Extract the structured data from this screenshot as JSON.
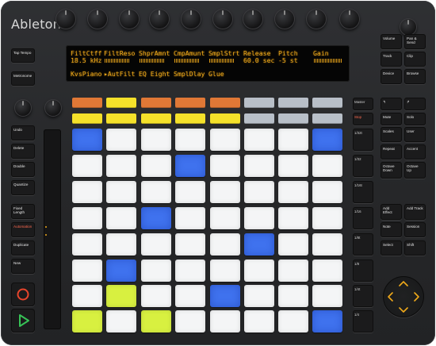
{
  "brand": "Ableton",
  "display": {
    "row1": [
      "FiltCtff",
      "FiltReso",
      "ShprAmnt",
      "CmpAmunt",
      "SmplStrt",
      "Release",
      "Pitch",
      "Gain"
    ],
    "row2": [
      "18.5 kHz",
      "",
      "",
      "",
      "",
      "60.0 sec",
      "-5 st",
      ""
    ],
    "row3": [
      "KvsPiano",
      "▸AutFilt",
      "EQ Eight",
      "SmplDlay",
      "Glue"
    ],
    "color": "#f0a91a"
  },
  "left_buttons": {
    "tap_tempo": "Tap Tempo",
    "metronome": "Metronome",
    "undo": "Undo",
    "delete": "Delete",
    "double": "Double",
    "quantize": "Quantize",
    "fixed_length": "Fixed Length",
    "automation": "Automation",
    "duplicate": "Duplicate",
    "new": "New"
  },
  "right_buttons": {
    "volume": "Volume",
    "pan_send": "Pan & Send",
    "track": "Track",
    "clip": "Clip",
    "device": "Device",
    "browse": "Browse",
    "nav_left": "↰",
    "nav_right": "↱",
    "mute": "Mute",
    "solo": "Solo",
    "scales": "Scales",
    "user": "User",
    "repeat": "Repeat",
    "accent": "Accent",
    "octave_down": "Octave Down",
    "octave_up": "Octave Up",
    "add_effect": "Add Effect",
    "add_track": "Add Track",
    "note": "Note",
    "session": "Session",
    "select": "Select",
    "shift": "Shift"
  },
  "scene_buttons": {
    "master": "Master",
    "stop": "Stop",
    "labels": [
      "1/32t",
      "1/32",
      "1/16t",
      "1/16",
      "1/8t",
      "1/8",
      "1/4t",
      "1/4"
    ]
  },
  "track_select_colors": [
    "#e07836",
    "#f5e12a",
    "#e07836",
    "#e07836",
    "#e07836",
    "#b8bfc8",
    "#b8bfc8",
    "#b8bfc8"
  ],
  "track_state_colors": [
    "#f5e12a",
    "#f5e12a",
    "#f5e12a",
    "#f5e12a",
    "#f5e12a",
    "#b8bfc8",
    "#b8bfc8",
    "#b8bfc8"
  ],
  "pad_colors": {
    "white": "#f4f5f6",
    "blue": "#3f72ee",
    "lime": "#d8f040"
  },
  "pad_grid": [
    [
      "blue",
      "white",
      "white",
      "white",
      "white",
      "white",
      "white",
      "blue"
    ],
    [
      "white",
      "white",
      "white",
      "blue",
      "white",
      "white",
      "white",
      "white"
    ],
    [
      "white",
      "white",
      "white",
      "white",
      "white",
      "white",
      "white",
      "white"
    ],
    [
      "white",
      "white",
      "blue",
      "white",
      "white",
      "white",
      "white",
      "white"
    ],
    [
      "white",
      "white",
      "white",
      "white",
      "white",
      "blue",
      "white",
      "white"
    ],
    [
      "white",
      "blue",
      "white",
      "white",
      "white",
      "white",
      "white",
      "white"
    ],
    [
      "white",
      "lime",
      "white",
      "white",
      "blue",
      "white",
      "white",
      "white"
    ],
    [
      "lime",
      "white",
      "lime",
      "white",
      "white",
      "white",
      "white",
      "blue"
    ]
  ],
  "transport": {
    "record_color": "#e8452c",
    "play_color": "#37c256"
  }
}
